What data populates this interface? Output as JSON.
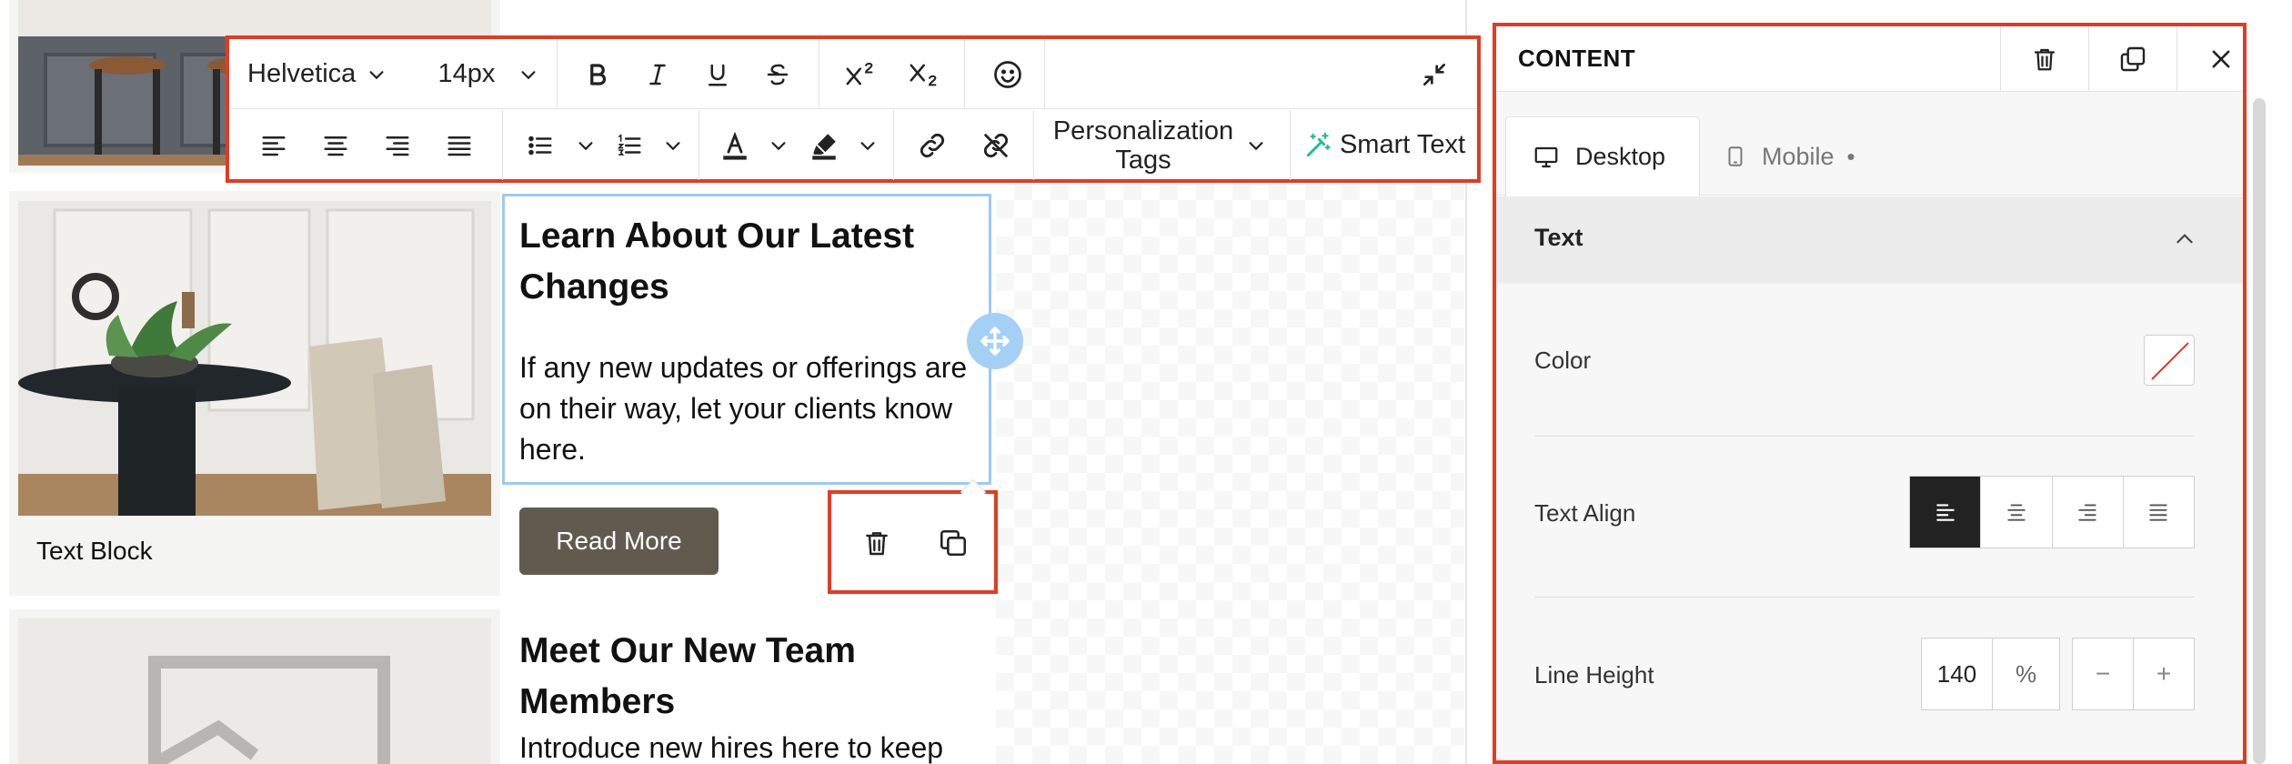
{
  "toolbar": {
    "font_family": "Helvetica",
    "font_size": "14px",
    "personalization": [
      "Personalization",
      "Tags"
    ],
    "smart_text": "Smart Text"
  },
  "email": {
    "card1": {
      "caption": "Text Block"
    },
    "block1": {
      "title_lines": [
        "Learn About Our Latest",
        "Changes"
      ],
      "body_lines": [
        "If any new updates or offerings are",
        "on their way, let your clients know",
        "here."
      ],
      "button": "Read More"
    },
    "block2": {
      "title_lines": [
        "Meet Our New Team",
        "Members"
      ],
      "body_lines": [
        "Introduce new hires here to keep"
      ]
    }
  },
  "panel": {
    "title": "CONTENT",
    "tabs": {
      "desktop": "Desktop",
      "mobile": "Mobile",
      "mobile_dot": "•"
    },
    "section": "Text",
    "color_label": "Color",
    "align_label": "Text Align",
    "align_selected": "left",
    "line_height_label": "Line Height",
    "line_height_value": "140",
    "line_height_unit": "%",
    "decrement": "−",
    "increment": "+"
  },
  "colors": {
    "highlight": "#e33b22",
    "selection": "#9ec9ee",
    "button": "#615a4f",
    "smart_text_icon": "#1fbf8f"
  }
}
